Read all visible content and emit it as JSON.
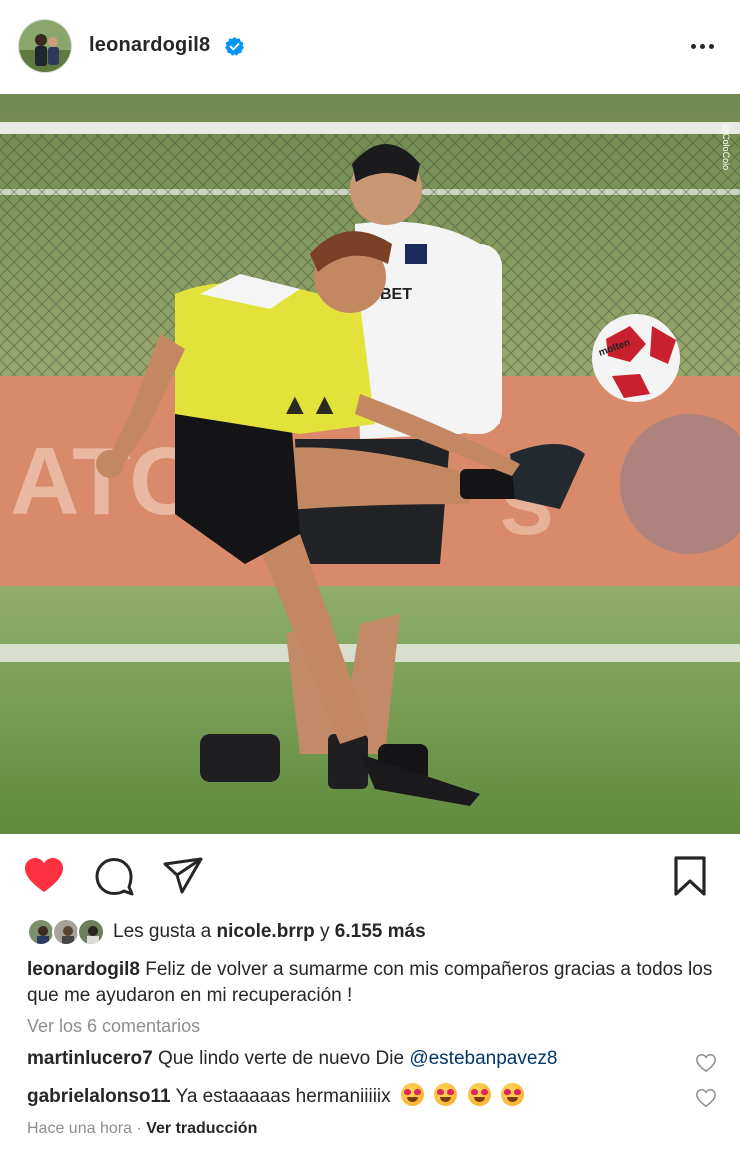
{
  "post": {
    "username": "leonardogil8",
    "verified": true
  },
  "icons": {
    "more": "more-options-icon",
    "like": "heart-filled-icon",
    "comment": "comment-icon",
    "share": "send-icon",
    "save": "bookmark-icon",
    "verified": "verified-badge-icon"
  },
  "colors": {
    "like_red": "#ff3040",
    "verified_blue": "#0095f6",
    "mention_blue": "#00376b",
    "muted_gray": "#8e8e8e"
  },
  "likes": {
    "prefix": "Les gusta a",
    "user": "nicole.brrp",
    "connector": "y",
    "count": "6.155 más"
  },
  "caption": {
    "username": "leonardogil8",
    "text": "Feliz de volver a sumarme con mis compañeros gracias a todos los que me ayudaron en mi recuperación !"
  },
  "view_comments": "Ver los 6 comentarios",
  "comments": [
    {
      "user": "martinlucero7",
      "text": "Que lindo verte de nuevo Die",
      "mention": "@estebanpavez8",
      "emoji_count": 0
    },
    {
      "user": "gabrielalonso11",
      "text": "Ya estaaaaas hermaniiiiix",
      "mention": "",
      "emoji_count": 4
    }
  ],
  "footer": {
    "time": "Hace una hora",
    "separator": "·",
    "translate": "Ver traducción"
  },
  "photo": {
    "watermark": "@ColoColo",
    "shirt_sponsor": "BET",
    "ball_brand": "molten"
  }
}
